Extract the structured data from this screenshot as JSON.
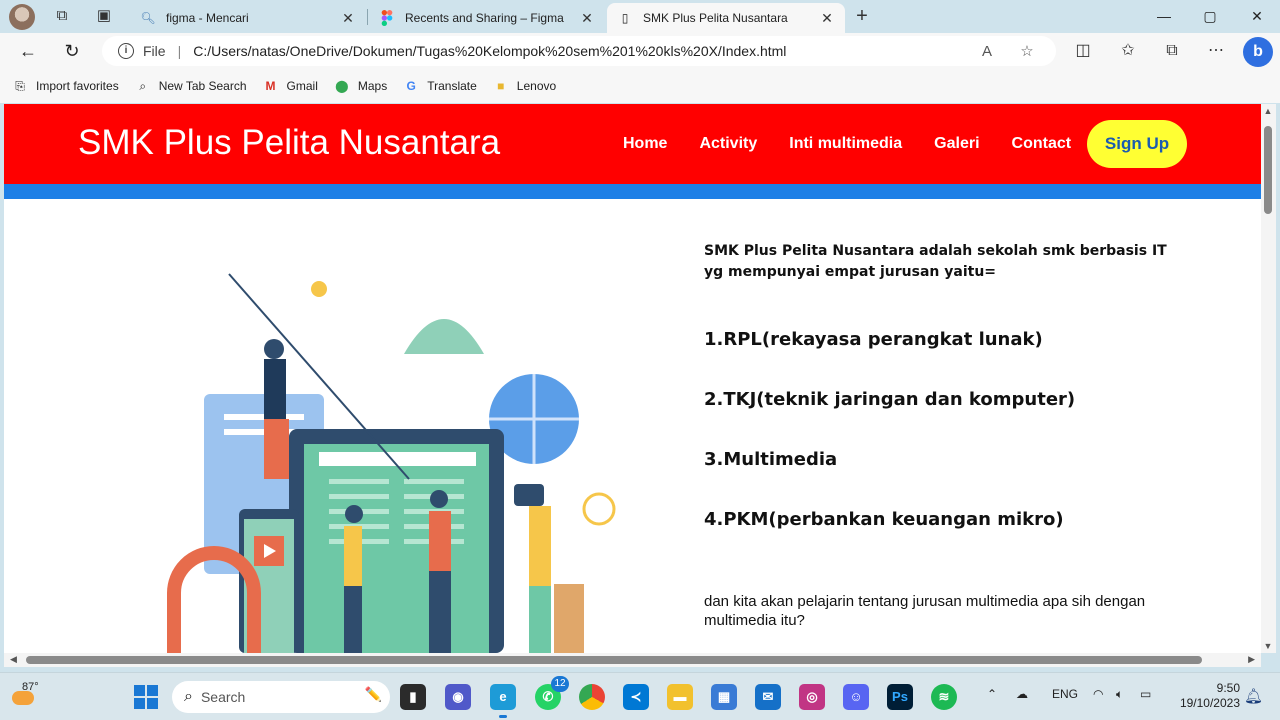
{
  "browser": {
    "tabs": [
      {
        "label": "figma - Mencari",
        "icon": "search-icon"
      },
      {
        "label": "Recents and Sharing – Figma",
        "icon": "figma-icon"
      },
      {
        "label": "SMK Plus Pelita Nusantara",
        "icon": "page-icon",
        "active": true
      }
    ],
    "address": {
      "scheme_label": "File",
      "url": "C:/Users/natas/OneDrive/Dokumen/Tugas%20Kelompok%20sem%201%20kls%20X/Index.html"
    },
    "favorites": [
      {
        "label": "Import favorites",
        "icon": "import-icon"
      },
      {
        "label": "New Tab Search",
        "icon": "search-icon"
      },
      {
        "label": "Gmail",
        "icon": "gmail-icon"
      },
      {
        "label": "Maps",
        "icon": "maps-icon"
      },
      {
        "label": "Translate",
        "icon": "translate-icon"
      },
      {
        "label": "Lenovo",
        "icon": "folder-icon"
      }
    ]
  },
  "site": {
    "title": "SMK Plus Pelita Nusantara",
    "nav": [
      "Home",
      "Activity",
      "Inti multimedia",
      "Galeri",
      "Contact"
    ],
    "signup_label": "Sign Up",
    "colors": {
      "header": "#ff0000",
      "accent_bar": "#1e7fe6",
      "signup": "#ffff33"
    },
    "intro": "SMK Plus Pelita Nusantara adalah sekolah smk berbasis IT yg mempunyai empat jurusan yaitu=",
    "majors": [
      "1.RPL(rekayasa perangkat lunak)",
      "2.TKJ(teknik jaringan dan komputer)",
      "3.Multimedia",
      "4.PKM(perbankan keuangan mikro)"
    ],
    "outro": "dan kita akan pelajarin tentang jurusan multimedia apa sih dengan multimedia itu?"
  },
  "taskbar": {
    "weather_temp": "87°",
    "search_placeholder": "Search",
    "whatsapp_badge": "12",
    "language": "ENG",
    "time": "9:50",
    "date": "19/10/2023"
  }
}
